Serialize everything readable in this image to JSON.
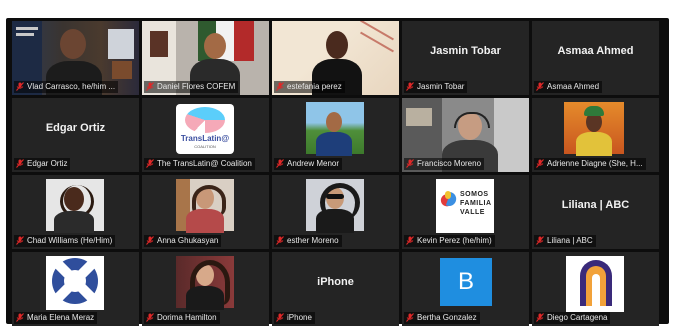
{
  "meeting": {
    "tiles": [
      {
        "name": "Vlad Carrasco, he/him ...",
        "type": "video",
        "active": true
      },
      {
        "name": "Daniel Flores COFEM",
        "type": "video"
      },
      {
        "name": "estefania perez",
        "type": "video"
      },
      {
        "name": "Jasmin Tobar",
        "type": "name",
        "display": "Jasmin Tobar"
      },
      {
        "name": "Asmaa Ahmed",
        "type": "name",
        "display": "Asmaa Ahmed"
      },
      {
        "name": "Edgar Ortiz",
        "type": "name",
        "display": "Edgar Ortiz"
      },
      {
        "name": "The TransLatin@ Coalition",
        "type": "logo",
        "logo_text": "TransLatin@",
        "logo_sub": "COALITION"
      },
      {
        "name": "Andrew Menor",
        "type": "video"
      },
      {
        "name": "Francisco Moreno",
        "type": "video"
      },
      {
        "name": "Adrienne Diagne (She, H...",
        "type": "video"
      },
      {
        "name": "Chad Williams (He/Him)",
        "type": "video"
      },
      {
        "name": "Anna Ghukasyan",
        "type": "video"
      },
      {
        "name": "esther Moreno",
        "type": "video"
      },
      {
        "name": "Kevin Perez (he/him)",
        "type": "logo",
        "logo_lines": [
          "SOMOS",
          "FAMILIA",
          "VALLE"
        ]
      },
      {
        "name": "Liliana | ABC",
        "type": "name",
        "display": "Liliana | ABC"
      },
      {
        "name": "Maria Elena Meraz",
        "type": "logo"
      },
      {
        "name": "Dorima Hamilton",
        "type": "video"
      },
      {
        "name": "iPhone",
        "type": "name",
        "display": "iPhone"
      },
      {
        "name": "Bertha Gonzalez",
        "type": "avatar",
        "letter": "B"
      },
      {
        "name": "Diego Cartagena",
        "type": "logo"
      }
    ],
    "colors": {
      "background": "#0d0d0d",
      "tile": "#242424",
      "active_outline": "#e3e08a",
      "muted_mic": "#e02828",
      "avatar_blue": "#1f8ee0"
    }
  }
}
